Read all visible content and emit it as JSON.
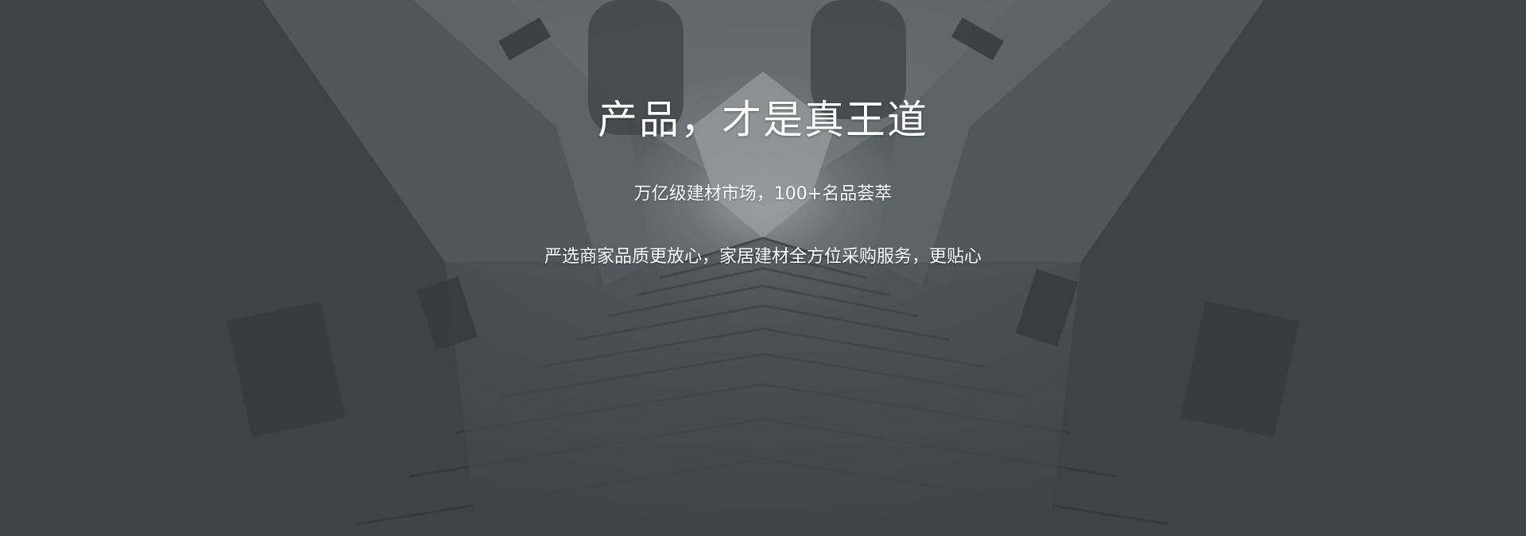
{
  "hero": {
    "title": "产品，才是真王道",
    "subtitle": "万亿级建材市场，100+名品荟萃",
    "tagline": "严选商家品质更放心，家居建材全方位采购服务，更贴心"
  },
  "colors": {
    "text": "#ffffff",
    "overlay": "#464c50"
  }
}
